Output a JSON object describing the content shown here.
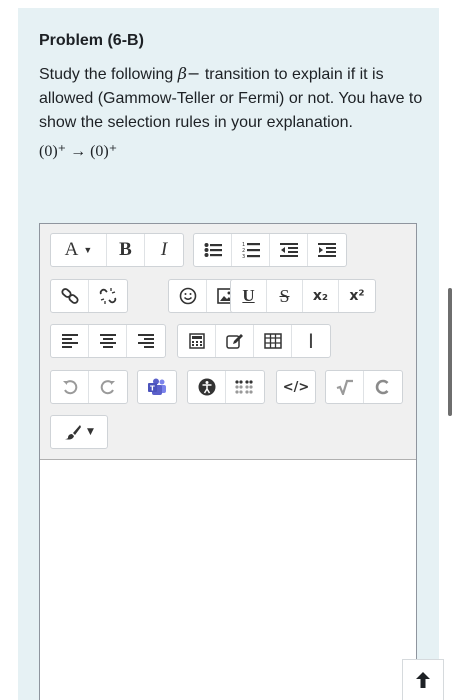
{
  "question": {
    "title": "Problem (6-B)",
    "text_before": "Study the following ",
    "beta": "β−",
    "text_after": " transition to explain if it is allowed (Gammow-Teller or Fermi) or not. You have to show the selection rules in your explanation.",
    "formula": "(0)⁺ → (0)⁺"
  },
  "toolbar": {
    "font_size_label": "A",
    "bold_label": "B",
    "italic_label": "I",
    "underline_label": "U",
    "strike_label": "S",
    "subscript_label": "x₂",
    "superscript_label": "x²",
    "html_label": "</>"
  },
  "colors": {
    "card_bg": "#e6f1f4",
    "toolbar_bg": "#f0f0f0",
    "teams_purple": "#5a5fc9"
  }
}
